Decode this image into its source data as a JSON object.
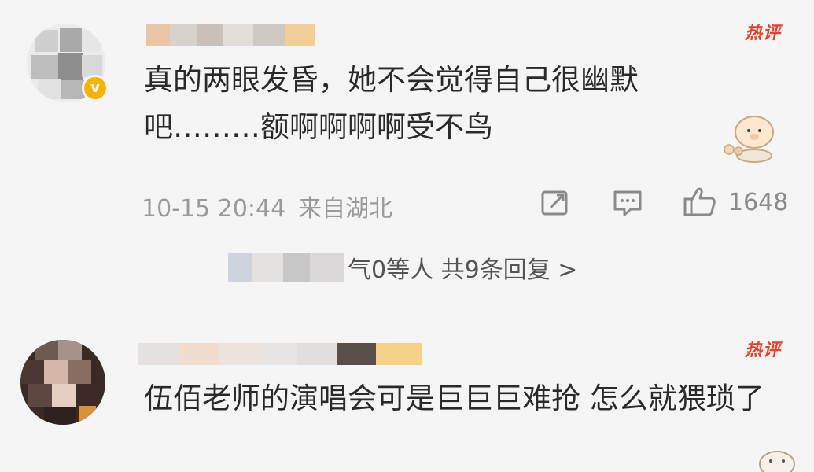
{
  "comments": [
    {
      "hot_label": "热评",
      "text": "真的两眼发昏，她不会觉得自己很幽默吧………额啊啊啊啊受不鸟",
      "time": "10-15 20:44",
      "location": "来自湖北",
      "likes": "1648",
      "replies_text": "气0等人  共9条回复 >"
    },
    {
      "hot_label": "热评",
      "text": "伍佰老师的演唱会可是巨巨巨难抢 怎么就猥琐了"
    }
  ],
  "icons": {
    "share": "share-icon",
    "comment": "comment-icon",
    "like": "thumbs-up-icon",
    "verified": "verified-badge-icon"
  },
  "colors": {
    "hot": "#e8412c",
    "meta": "#9a9a9a",
    "background": "#f6f5f5",
    "verified": "#f4b400"
  }
}
